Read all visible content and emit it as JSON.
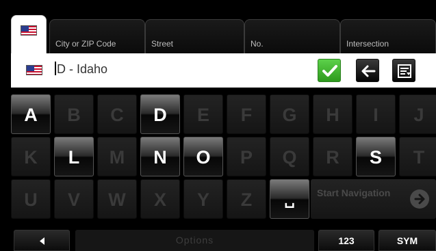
{
  "tabs": [
    {
      "label": "City or ZIP Code"
    },
    {
      "label": "Street"
    },
    {
      "label": "No."
    },
    {
      "label": "Intersection"
    }
  ],
  "input": {
    "value": "D - Idaho"
  },
  "keyboard": {
    "row1": [
      {
        "label": "A",
        "enabled": true
      },
      {
        "label": "B",
        "enabled": false
      },
      {
        "label": "C",
        "enabled": false
      },
      {
        "label": "D",
        "enabled": true
      },
      {
        "label": "E",
        "enabled": false
      },
      {
        "label": "F",
        "enabled": false
      },
      {
        "label": "G",
        "enabled": false
      },
      {
        "label": "H",
        "enabled": false
      },
      {
        "label": "I",
        "enabled": false
      },
      {
        "label": "J",
        "enabled": false
      }
    ],
    "row2": [
      {
        "label": "K",
        "enabled": false
      },
      {
        "label": "L",
        "enabled": true
      },
      {
        "label": "M",
        "enabled": false
      },
      {
        "label": "N",
        "enabled": true
      },
      {
        "label": "O",
        "enabled": true
      },
      {
        "label": "P",
        "enabled": false
      },
      {
        "label": "Q",
        "enabled": false
      },
      {
        "label": "R",
        "enabled": false
      },
      {
        "label": "S",
        "enabled": true
      },
      {
        "label": "T",
        "enabled": false
      }
    ],
    "row3": [
      {
        "label": "U",
        "enabled": false
      },
      {
        "label": "V",
        "enabled": false
      },
      {
        "label": "W",
        "enabled": false
      },
      {
        "label": "X",
        "enabled": false
      },
      {
        "label": "Y",
        "enabled": false
      },
      {
        "label": "Z",
        "enabled": false
      },
      {
        "label": "␣",
        "enabled": true
      }
    ],
    "start_navigation": "Start Navigation"
  },
  "bottom": {
    "options": "Options",
    "numbers": "123",
    "symbols": "SYM"
  },
  "colors": {
    "confirm": "#3cb52a",
    "enabled_key": "#ffffff",
    "disabled_key": "#3a3a3a"
  },
  "icons": [
    "us-flag-icon",
    "checkmark-icon",
    "backspace-arrow-icon",
    "list-icon",
    "arrow-right-icon",
    "triangle-left-icon"
  ]
}
